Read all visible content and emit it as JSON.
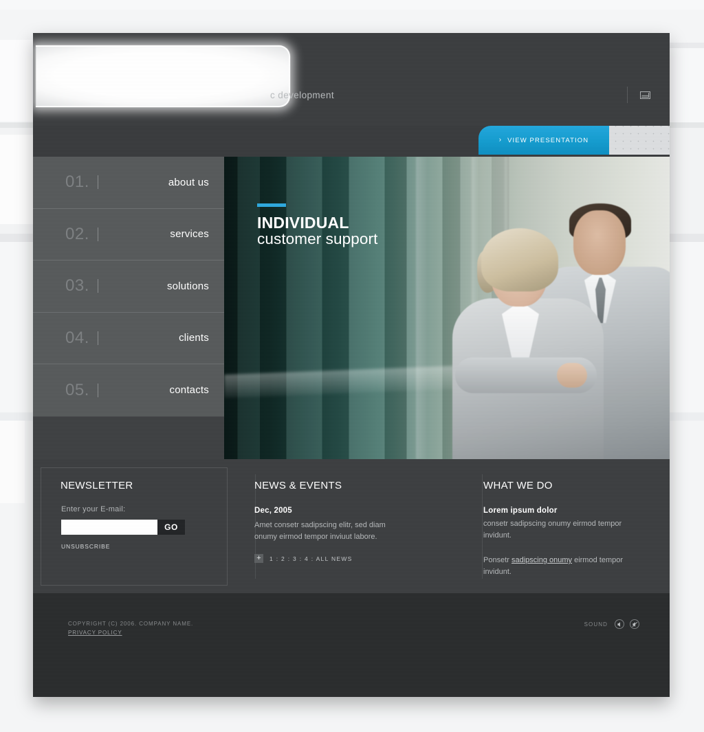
{
  "header": {
    "tagline": "c development",
    "mail_icon": "envelope-icon"
  },
  "presentation_tab": {
    "chevron": "›",
    "label": "VIEW PRESENTATION"
  },
  "nav": {
    "items": [
      {
        "num": "01.",
        "label": "about us"
      },
      {
        "num": "02.",
        "label": "services"
      },
      {
        "num": "03.",
        "label": "solutions"
      },
      {
        "num": "04.",
        "label": "clients"
      },
      {
        "num": "05.",
        "label": "contacts"
      }
    ]
  },
  "hero": {
    "title_line1": "INDIVIDUAL",
    "title_line2": "customer support",
    "accent_color": "#2fa8dc"
  },
  "newsletter": {
    "title": "NEWSLETTER",
    "field_label": "Enter your E-mail:",
    "input_value": "",
    "input_placeholder": "",
    "go_label": "GO",
    "unsubscribe_label": "UNSUBSCRIBE"
  },
  "news": {
    "title": "NEWS & EVENTS",
    "date": "Dec, 2005",
    "body": "Amet consetr sadipscing elitr, sed diam onumy eirmod tempor inviuut labore.",
    "pager_plus": "+",
    "pager_links": "1 : 2 : 3 : 4 : ALL NEWS"
  },
  "what_we_do": {
    "title": "WHAT WE DO",
    "lead": "Lorem ipsum dolor",
    "body1": "consetr sadipscing onumy eirmod tempor invidunt.",
    "body2_pre": "Ponsetr ",
    "body2_link": "sadipscing onumy",
    "body2_post": " eirmod tempor invidunt."
  },
  "footer": {
    "copyright": "COPYRIGHT (C) 2006. COMPANY NAME.",
    "privacy": "PRIVACY POLICY",
    "sound_label": "SOUND",
    "sound_on_icon": "speaker-on-icon",
    "sound_off_icon": "speaker-off-icon"
  },
  "theme": {
    "page_bg": "#3a3c3e",
    "footer_bg": "#2b2d2e",
    "accent": "#1b9cd8",
    "nav_item_bg": "#585b5c"
  }
}
